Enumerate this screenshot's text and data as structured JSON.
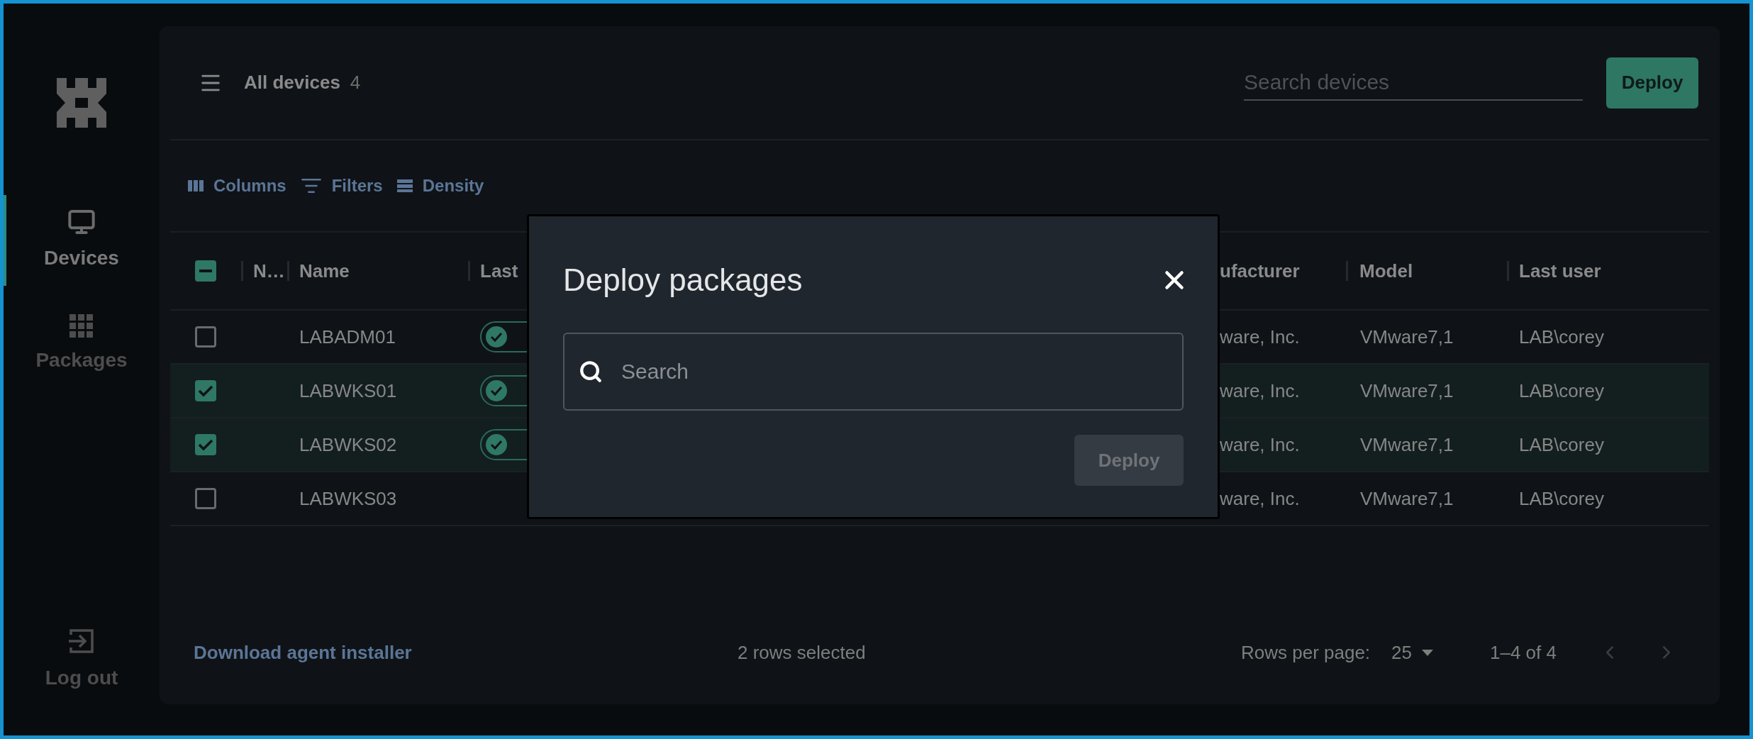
{
  "sidebar": {
    "items": [
      {
        "label": "Devices",
        "kind": "monitor",
        "selected": true
      },
      {
        "label": "Packages",
        "kind": "grid",
        "selected": false
      }
    ],
    "logout": "Log out"
  },
  "header": {
    "title": "All devices",
    "count": "4",
    "search_placeholder": "Search devices",
    "deploy_button": "Deploy"
  },
  "toolbar": [
    {
      "label": "Columns",
      "kind": "columns"
    },
    {
      "label": "Filters",
      "kind": "filters"
    },
    {
      "label": "Density",
      "kind": "density"
    }
  ],
  "table": {
    "select_all_indeterminate": true,
    "columns": [
      "N…",
      "Name",
      "Last",
      "ufacturer",
      "Model",
      "Last user"
    ],
    "rows": [
      {
        "selected": false,
        "name": "LABADM01",
        "status_ok": true,
        "manufacturer": "ware, Inc.",
        "model": "VMware7,1",
        "last_user": "LAB\\corey"
      },
      {
        "selected": true,
        "name": "LABWKS01",
        "status_ok": true,
        "manufacturer": "ware, Inc.",
        "model": "VMware7,1",
        "last_user": "LAB\\corey"
      },
      {
        "selected": true,
        "name": "LABWKS02",
        "status_ok": true,
        "manufacturer": "ware, Inc.",
        "model": "VMware7,1",
        "last_user": "LAB\\corey"
      },
      {
        "selected": false,
        "name": "LABWKS03",
        "status_ok": false,
        "manufacturer": "ware, Inc.",
        "model": "VMware7,1",
        "last_user": "LAB\\corey"
      }
    ]
  },
  "footer": {
    "download_link": "Download agent installer",
    "selection": "2 rows selected",
    "rows_per_page_label": "Rows per page:",
    "rows_per_page": "25",
    "range": "1–4 of 4"
  },
  "modal": {
    "title": "Deploy packages",
    "search_placeholder": "Search",
    "button": "Deploy",
    "button_disabled": true
  }
}
